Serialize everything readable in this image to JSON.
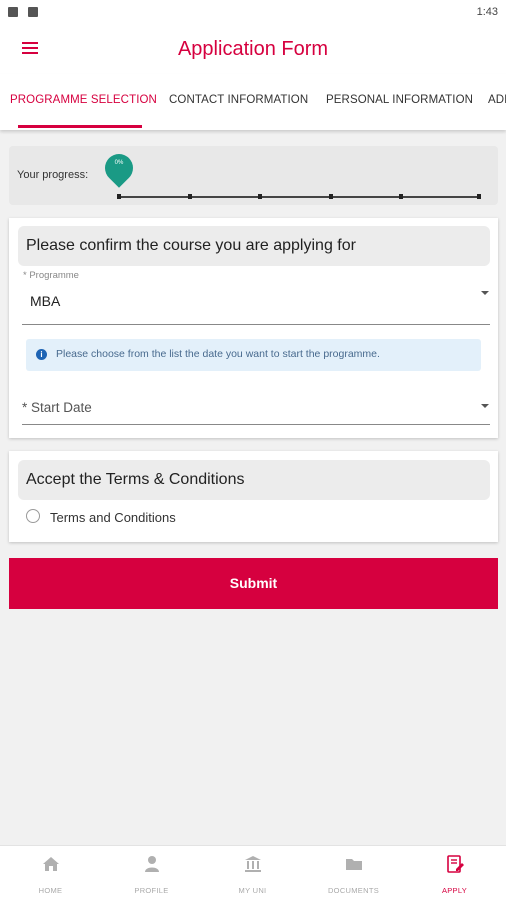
{
  "status_bar": {
    "time": "1:43"
  },
  "app_bar": {
    "title": "Application Form"
  },
  "tabs": [
    {
      "label": "PROGRAMME SELECTION",
      "active": true
    },
    {
      "label": "CONTACT INFORMATION",
      "active": false
    },
    {
      "label": "PERSONAL INFORMATION",
      "active": false
    },
    {
      "label": "ADI",
      "active": false
    }
  ],
  "progress": {
    "label": "Your progress:",
    "pin_text": "0%",
    "value": 0,
    "steps": 6
  },
  "course_card": {
    "heading": "Please confirm the course you are applying for",
    "programme_label": "* Programme",
    "programme_value": "MBA",
    "info_text": "Please choose from the list the date you want to start the programme.",
    "start_date_placeholder": "* Start Date"
  },
  "terms_card": {
    "heading": "Accept the Terms & Conditions",
    "radio_label": "Terms and Conditions"
  },
  "submit_label": "Submit",
  "bottom_nav": [
    {
      "label": "HOME",
      "icon": "home-icon",
      "active": false
    },
    {
      "label": "PROFILE",
      "icon": "profile-icon",
      "active": false
    },
    {
      "label": "MY UNI",
      "icon": "university-icon",
      "active": false
    },
    {
      "label": "DOCUMENTS",
      "icon": "folder-icon",
      "active": false
    },
    {
      "label": "APPLY",
      "icon": "apply-icon",
      "active": true
    }
  ],
  "colors": {
    "accent": "#d6003f",
    "progress_pin": "#1a9a85",
    "info_bg": "#e3f0fa"
  }
}
